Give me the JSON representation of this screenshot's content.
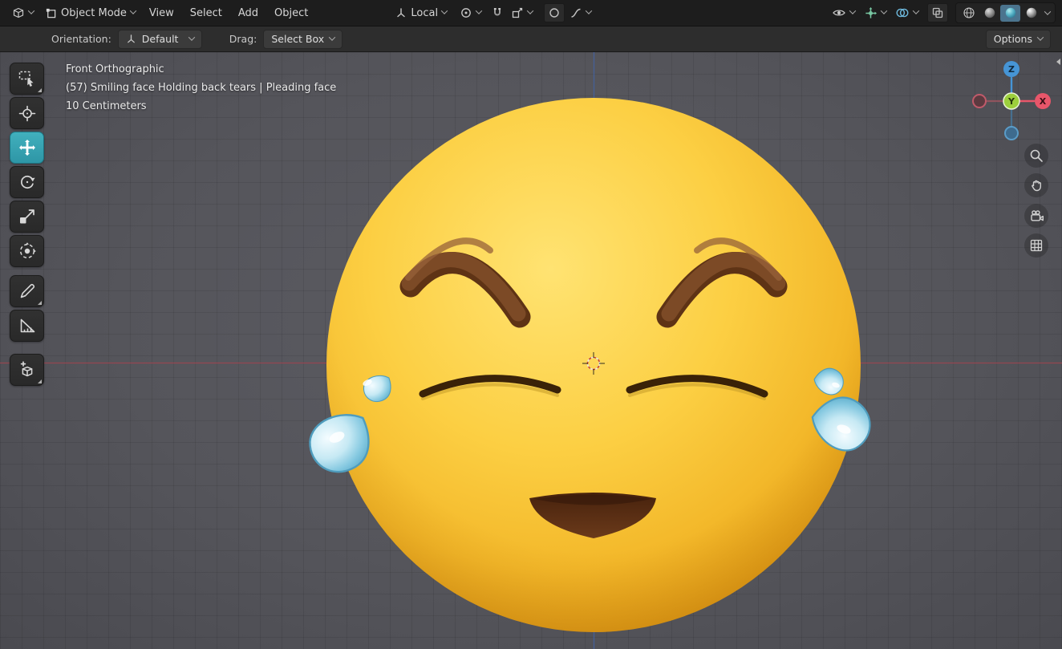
{
  "header": {
    "mode_label": "Object Mode",
    "menus": [
      {
        "label": "View"
      },
      {
        "label": "Select"
      },
      {
        "label": "Add"
      },
      {
        "label": "Object"
      }
    ],
    "transform_orientation_label": "Local"
  },
  "tool_settings": {
    "orientation_label": "Orientation:",
    "orientation_value": "Default",
    "drag_label": "Drag:",
    "drag_value": "Select Box",
    "options_label": "Options"
  },
  "viewport_overlay": {
    "view_label": "Front Orthographic",
    "object_label": "(57) Smiling face Holding back tears | Pleading face",
    "scale_label": "10 Centimeters"
  },
  "nav_gizmo": {
    "x": "X",
    "y": "Y",
    "z": "Z"
  },
  "left_toolbar": {
    "active_tool": "move",
    "icons": [
      "select-box-icon",
      "cursor-icon",
      "move-icon",
      "rotate-icon",
      "scale-icon",
      "transform-icon",
      "annotate-icon",
      "measure-icon",
      "add-cube-icon"
    ]
  },
  "icons": {
    "header_left": [
      "editor-type-icon",
      "object-mode-icon"
    ],
    "header_center": [
      "transform-orientation-icon",
      "pivot-point-icon",
      "snap-magnet-icon",
      "snap-target-icon",
      "proportional-editing-icon",
      "proportional-falloff-icon"
    ],
    "header_right": [
      "visibility-eye-icon",
      "gizmos-icon",
      "overlays-icon",
      "xray-icon",
      "shading-wireframe-icon",
      "shading-solid-icon",
      "shading-material-icon",
      "shading-rendered-icon"
    ],
    "side_nav": [
      "zoom-icon",
      "pan-hand-icon",
      "camera-view-icon",
      "toggle-grid-icon"
    ]
  },
  "scene": {
    "object": "smiling-face-holding-back-tears-emoji"
  },
  "colors": {
    "active_tool": "#35a3b3",
    "emoji_face": "#fbc93d",
    "emoji_brow": "#7c4a26",
    "emoji_mouth": "#5a2f14",
    "tear": "#8ecbe0",
    "axis_x": "#9c4550",
    "axis_z": "#44629e",
    "gizmo_x": "#e8566a",
    "gizmo_y": "#9ccf3c",
    "gizmo_z": "#4695d6"
  }
}
